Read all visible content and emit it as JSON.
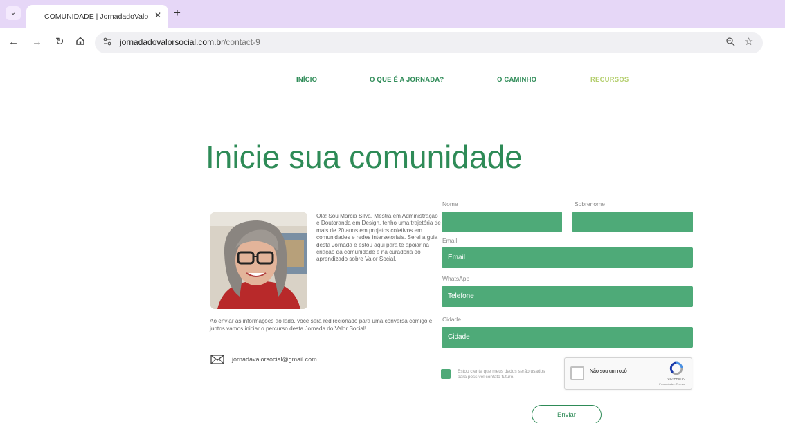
{
  "browser": {
    "tab_title": "COMUNIDADE | JornadadoValor...",
    "tab_close": "✕",
    "new_tab": "+",
    "url_host": "jornadadovalorsocial.com.br",
    "url_path": "/contact-9"
  },
  "icons": {
    "tab_list": "chevron-down-icon",
    "back": "back-arrow-icon",
    "forward": "forward-arrow-icon",
    "reload": "reload-icon",
    "home": "home-icon",
    "site_info": "tune-icon",
    "zoom": "zoom-icon",
    "bookmark": "star-icon",
    "email": "envelope-icon"
  },
  "nav": {
    "items": [
      {
        "label": "INÍCIO"
      },
      {
        "label": "O QUE É A JORNADA?"
      },
      {
        "label": "O CAMINHO"
      },
      {
        "label": "RECURSOS"
      }
    ]
  },
  "page": {
    "title": "Inicie sua comunidade"
  },
  "profile": {
    "bio": "Olá! Sou Marcia Silva, Mestra em Administração e Doutoranda em Design, tenho uma trajetória de mais de 20 anos em projetos coletivos em comunidades e redes intersetoriais. Serei a guia desta Jornada e estou aqui para te apoiar na criação da comunidade e na curadoria do aprendizado sobre Valor Social.",
    "redirect_note": "Ao enviar as informações ao lado, você será redirecionado para uma conversa comigo e juntos vamos iniciar o percurso desta Jornada do Valor Social!",
    "email": "jornadavalorsocial@gmail.com"
  },
  "form": {
    "first_name_label": "Nome",
    "last_name_label": "Sobrenome",
    "email_label": "Email",
    "email_placeholder": "Email",
    "whatsapp_label": "WhatsApp",
    "phone_placeholder": "Telefone",
    "city_label": "Cidade",
    "city_placeholder": "Cidade",
    "consent_text": "Estou ciente que meus dados serão usados para possível contato futuro.",
    "recaptcha_label": "Não sou um robô",
    "recaptcha_brand": "reCAPTCHA",
    "recaptcha_terms": "Privacidade - Termos",
    "submit_label": "Enviar"
  },
  "colors": {
    "brand_green": "#2e8b57",
    "field_green": "#4eaa78",
    "nav_active": "#b5cf6f",
    "tabbar": "#e6d7f7"
  }
}
